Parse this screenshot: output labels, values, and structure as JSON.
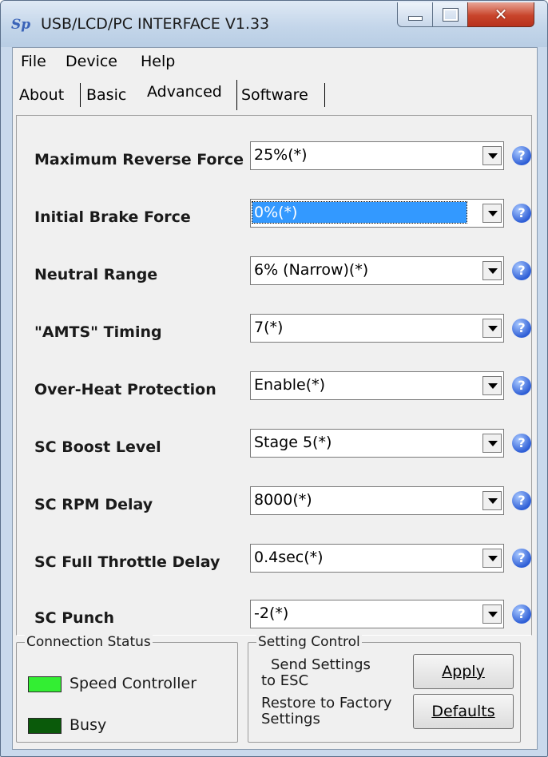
{
  "window": {
    "app_icon": "Sp",
    "title": "USB/LCD/PC INTERFACE V1.33"
  },
  "title_buttons": {
    "minimize": "minimize-icon",
    "maximize": "maximize-icon",
    "close": "close-icon"
  },
  "menu": [
    "File",
    "Device",
    "Help"
  ],
  "tabs": [
    "About",
    "Basic",
    "Advanced",
    "Software"
  ],
  "active_tab": "Advanced",
  "settings": [
    {
      "label": "Maximum Reverse Force",
      "value": "25%(*)"
    },
    {
      "label": "Initial Brake Force",
      "value": "0%(*)"
    },
    {
      "label": "Neutral Range",
      "value": "6% (Narrow)(*)"
    },
    {
      "label": "\"AMTS\" Timing",
      "value": "7(*)"
    },
    {
      "label": "Over-Heat Protection",
      "value": "Enable(*)"
    },
    {
      "label": "SC Boost Level",
      "value": "Stage 5(*)"
    },
    {
      "label": "SC RPM Delay",
      "value": "8000(*)"
    },
    {
      "label": "SC Full Throttle Delay",
      "value": "0.4sec(*)"
    },
    {
      "label": "SC Punch",
      "value": "-2(*)"
    }
  ],
  "help_glyph": "?",
  "connection_status": {
    "title": "Connection Status",
    "speed_controller": {
      "label": "Speed Controller",
      "color": "#33ee33"
    },
    "busy": {
      "label": "Busy",
      "color": "#0a5a0a"
    }
  },
  "setting_control": {
    "title": "Setting Control",
    "send_line1": "Send Settings",
    "send_line2": "to ESC",
    "restore_line1": "Restore to Factory",
    "restore_line2": "Settings",
    "apply_button": "Apply",
    "defaults_button": "Defaults"
  }
}
